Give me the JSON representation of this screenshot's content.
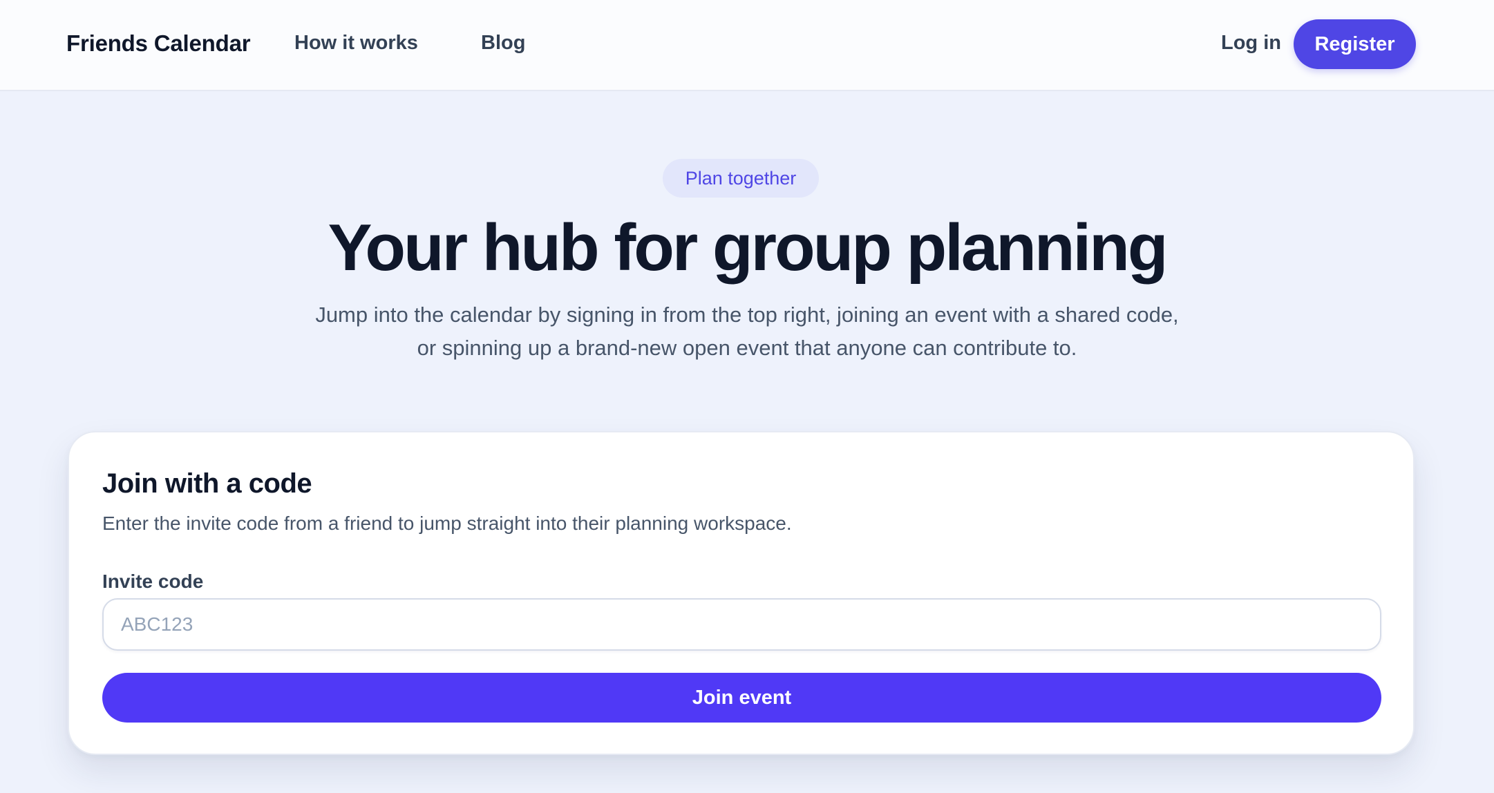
{
  "nav": {
    "brand": "Friends Calendar",
    "links": [
      "How it works",
      "Blog"
    ],
    "login": "Log in",
    "register": "Register"
  },
  "hero": {
    "pill": "Plan together",
    "title": "Your hub for group planning",
    "subtitle_line1": "Jump into the calendar by signing in from the top right, joining an event with a shared code,",
    "subtitle_line2": "or spinning up a brand-new open event that anyone can contribute to."
  },
  "join_card": {
    "title": "Join with a code",
    "description": "Enter the invite code from a friend to jump straight into their planning workspace.",
    "field_label": "Invite code",
    "input_value": "",
    "input_placeholder": "ABC123",
    "button": "Join event"
  },
  "colors": {
    "accent": "#4f46e5",
    "join_button": "#5039f6",
    "page_background": "#eef2fc",
    "pill_background": "#e2e6fb"
  }
}
